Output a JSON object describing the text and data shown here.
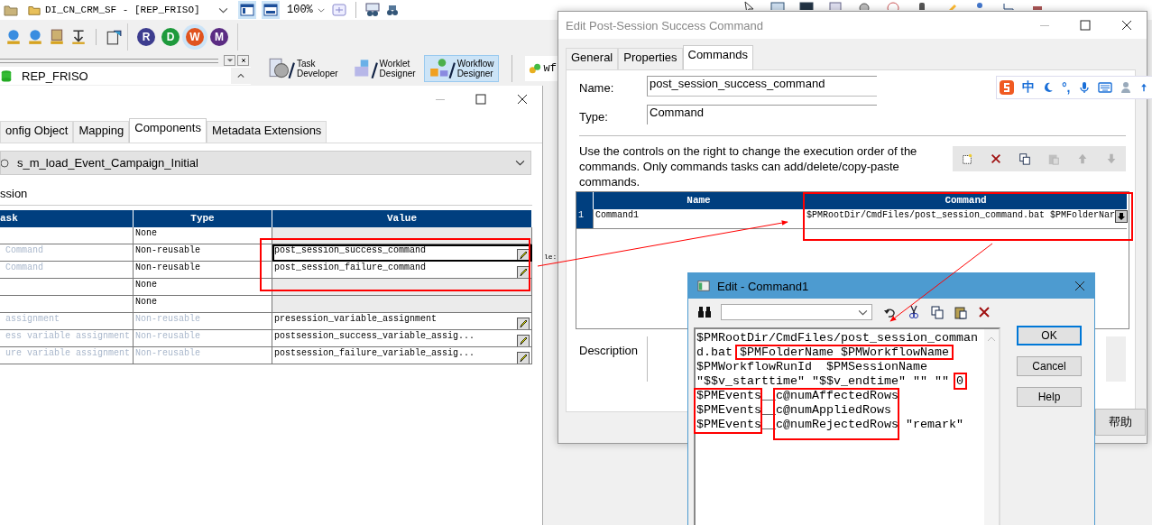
{
  "app": {
    "repository_combo": "DI_CN_CRM_SF - [REP_FRISO]",
    "zoom_combo": "100%",
    "view_buttons": [
      {
        "selected": true
      },
      {
        "selected": true
      }
    ],
    "client_buttons": [
      {
        "label": "R",
        "color": "#3d3d8f",
        "selected": false
      },
      {
        "label": "D",
        "color": "#1e9a3c",
        "selected": false
      },
      {
        "label": "W",
        "color": "#e0531f",
        "selected": true
      },
      {
        "label": "M",
        "color": "#5b2c83",
        "selected": false
      }
    ],
    "navigator_repository": "REP_FRISO",
    "tools": [
      {
        "lines": [
          "Task",
          "Developer"
        ],
        "kind": "task",
        "selected": false
      },
      {
        "lines": [
          "Worklet",
          "Designer"
        ],
        "kind": "worklet",
        "selected": false
      },
      {
        "lines": [
          "Workflow",
          "Designer"
        ],
        "kind": "workflow",
        "selected": true
      }
    ],
    "workspace_tab": "wf",
    "canvas_label": "le:"
  },
  "edit_tasks": {
    "tabs": [
      {
        "label": "onfig Object",
        "selected": false
      },
      {
        "label": "Mapping",
        "selected": false
      },
      {
        "label": "Components",
        "selected": true
      },
      {
        "label": "Metadata Extensions",
        "selected": false
      }
    ],
    "mapping_combo": "s_m_load_Event_Campaign_Initial",
    "section": "ssion",
    "columns": [
      "ask",
      "Type",
      "Value"
    ],
    "rows": [
      {
        "type": "None",
        "disabled": false,
        "selected": false
      },
      {
        "task": "Command",
        "type": "Non-reusable",
        "value": "post_session_success_command",
        "disabled": false,
        "selected": true
      },
      {
        "task": "Command",
        "type": "Non-reusable",
        "value": "post_session_failure_command",
        "disabled": false,
        "selected": false
      },
      {
        "type": "None",
        "disabled": false,
        "selected": false
      },
      {
        "type": "None",
        "disabled": false,
        "selected": false
      },
      {
        "task": "assignment",
        "type": "Non-reusable",
        "value": "presession_variable_assignment",
        "disabled": true,
        "selected": false
      },
      {
        "task": "ess variable assignment",
        "type": "Non-reusable",
        "value": "postsession_success_variable_assig...",
        "disabled": true,
        "selected": false
      },
      {
        "task": "ure variable assignment",
        "type": "Non-reusable",
        "value": "postsession_failure_variable_assig...",
        "disabled": true,
        "selected": false
      }
    ]
  },
  "command_dialog": {
    "title": "Edit Post-Session Success Command",
    "tabs": [
      {
        "label": "General",
        "selected": false
      },
      {
        "label": "Properties",
        "selected": false
      },
      {
        "label": "Commands",
        "selected": true
      }
    ],
    "name_label": "Name:",
    "name_value": "post_session_success_command",
    "type_label": "Type:",
    "type_value": "Command",
    "instructions": "Use the controls on the right to change the execution order of the commands.  Only commands tasks can add/delete/copy-paste commands.",
    "tools": [
      {
        "kind": "new",
        "disabled": false
      },
      {
        "kind": "delete",
        "disabled": false
      },
      {
        "kind": "copy",
        "disabled": false
      },
      {
        "kind": "paste",
        "disabled": true
      },
      {
        "kind": "up",
        "disabled": true
      },
      {
        "kind": "down",
        "disabled": true
      }
    ],
    "columns": [
      "Name",
      "Command"
    ],
    "rows": [
      {
        "number": "1",
        "name": "Command1",
        "command": "$PMRootDir/CmdFiles/post_session_command.bat $PMFolderNar"
      }
    ],
    "description_label": "Description",
    "help_button": "帮助"
  },
  "ime_bar": {
    "mode": "中",
    "punctuation": "°,"
  },
  "edit_dialog": {
    "title": "Edit  - Command1",
    "lines": [
      "$PMRootDir/CmdFiles/post_session_comman",
      "d.bat $PMFolderName $PMWorkflowName",
      "$PMWorkflowRunId  $PMSessionName",
      "\"$$v_starttime\" \"$$v_endtime\" \"\" \"\" 0",
      "$PMEvents__c@numAffectedRows",
      "$PMEvents__c@numAppliedRows",
      "$PMEvents__c@numRejectedRows \"remark\""
    ],
    "buttons": [
      {
        "label": "OK",
        "default": true
      },
      {
        "label": "Cancel",
        "default": false
      },
      {
        "label": "Help",
        "default": false
      }
    ]
  }
}
